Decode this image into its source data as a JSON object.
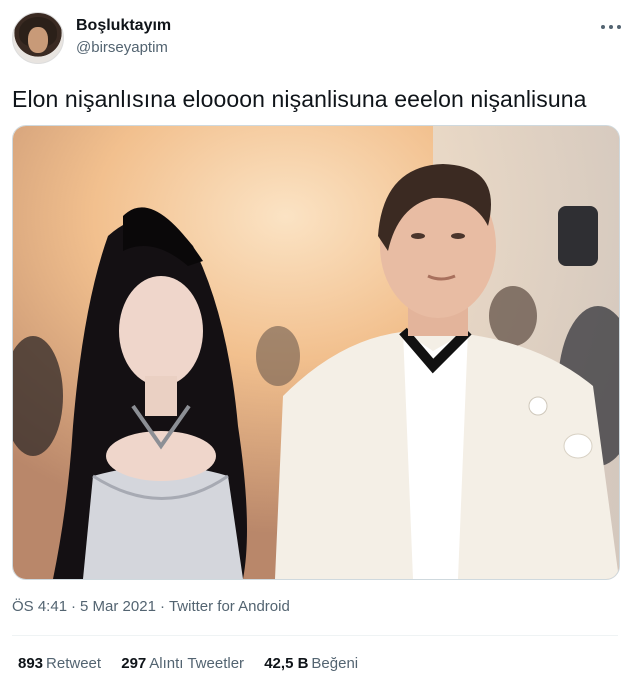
{
  "tweet": {
    "author_name": "Boşluktayım",
    "author_handle": "@birseyaptim",
    "text": "Elon nişanlısına eloooon nişanlisuna eeelon nişanlisuna",
    "time": "ÖS 4:41",
    "separator": "·",
    "date": "5 Mar 2021",
    "source": "Twitter for Android"
  },
  "stats": {
    "retweets_count": "893",
    "retweets_label": "Retweet",
    "quotes_count": "297",
    "quotes_label": "Alıntı Tweetler",
    "likes_count": "42,5 B",
    "likes_label": "Beğeni"
  },
  "icons": {
    "more": "more-options-icon"
  },
  "colors": {
    "text_primary": "#0f1419",
    "text_secondary": "#536471",
    "divider": "#eff3f4"
  }
}
